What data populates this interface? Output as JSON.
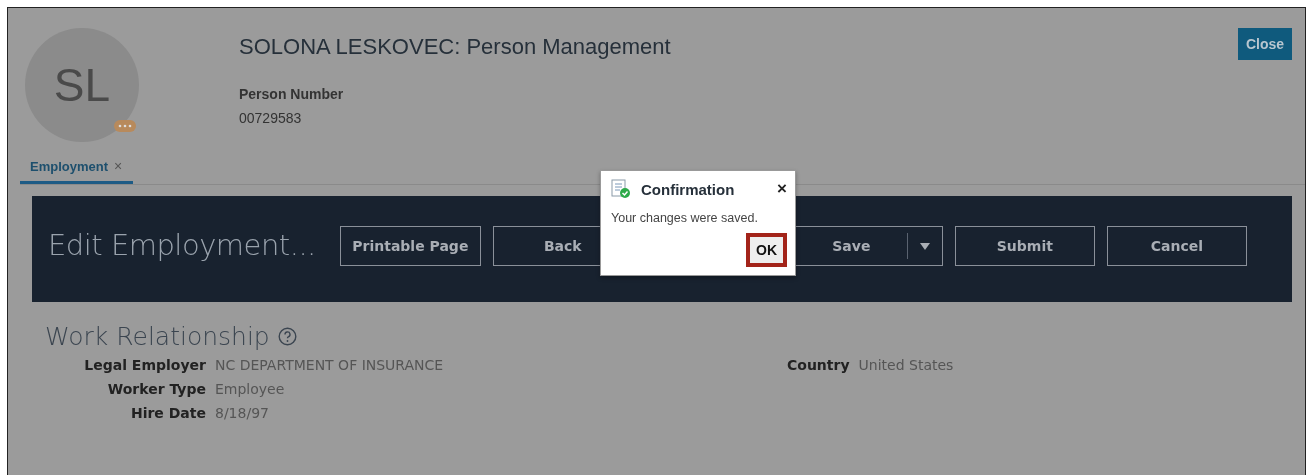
{
  "header": {
    "avatar_initials": "SL",
    "title": "SOLONA LESKOVEC: Person Management",
    "person_number_label": "Person Number",
    "person_number": "00729583",
    "close_button": {
      "label": "Close"
    }
  },
  "tabs": [
    {
      "label": "Employment",
      "selected": true,
      "close": "×"
    }
  ],
  "banner": {
    "title": "Edit Employment...",
    "buttons": [
      {
        "label": "Printable Page",
        "kind": "plain"
      },
      {
        "label": "Back",
        "kind": "plain"
      },
      {
        "label": "Save",
        "kind": "split"
      },
      {
        "label": "Submit",
        "kind": "plain"
      },
      {
        "label": "Cancel",
        "kind": "plain"
      }
    ]
  },
  "section": {
    "title": "Work Relationship",
    "fields_left": [
      {
        "label": "Legal Employer",
        "value": "NC DEPARTMENT OF INSURANCE"
      },
      {
        "label": "Worker Type",
        "value": "Employee"
      },
      {
        "label": "Hire Date",
        "value": "8/18/97"
      }
    ],
    "fields_right": [
      {
        "label": "Country",
        "value": "United States"
      }
    ]
  },
  "dialog": {
    "title": "Confirmation",
    "close": "×",
    "message": "Your changes were saved.",
    "ok_button": {
      "label": "OK",
      "highlighted": true
    }
  }
}
